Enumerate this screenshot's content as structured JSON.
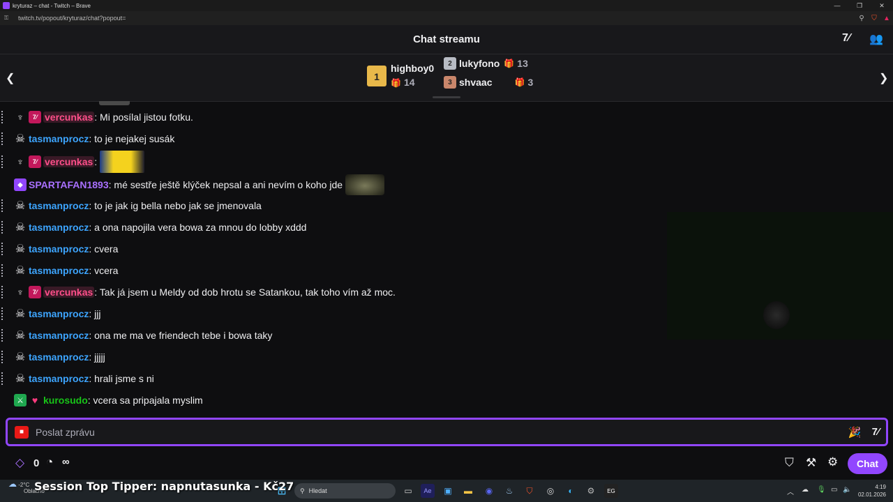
{
  "window": {
    "title": "kryturaz – chat - Twitch – Brave",
    "url": "twitch.tv/popout/kryturaz/chat?popout="
  },
  "header": {
    "title": "Chat streamu"
  },
  "leaderboard": {
    "entries": [
      {
        "rank": "1",
        "name": "highboy0",
        "count": "14"
      },
      {
        "rank": "2",
        "name": "lukyfono",
        "count": "13"
      },
      {
        "rank": "3",
        "name": "shvaac",
        "count": "3"
      }
    ]
  },
  "messages": [
    {
      "user": "vercunkas",
      "text": ": Mi posílal jistou fotku."
    },
    {
      "user": "tasmanprocz",
      "text": ": to je nejakej susák"
    },
    {
      "user": "vercunkas",
      "text": ":"
    },
    {
      "user": "SPARTAFAN1893",
      "text": ": mé sestře ještě klýček nepsal a ani nevím o koho jde"
    },
    {
      "user": "tasmanprocz",
      "text": ": to je jak ig bella nebo jak se jmenovala"
    },
    {
      "user": "tasmanprocz",
      "text": ": a ona napojila vera bowa za mnou do lobby xddd"
    },
    {
      "user": "tasmanprocz",
      "text": ": cvera"
    },
    {
      "user": "tasmanprocz",
      "text": ": vcera"
    },
    {
      "user": "vercunkas",
      "text": ": Tak já jsem u Meldy od dob hrotu se Satankou, tak toho vím až moc."
    },
    {
      "user": "tasmanprocz",
      "text": ": jjj"
    },
    {
      "user": "tasmanprocz",
      "text": ": ona me ma ve friendech tebe i bowa taky"
    },
    {
      "user": "tasmanprocz",
      "text": ": jjjjj"
    },
    {
      "user": "tasmanprocz",
      "text": ": hrali jsme s ni"
    },
    {
      "user": "kurosudo",
      "text": ": vcera sa pripajala myslim"
    }
  ],
  "input": {
    "placeholder": "Poslat zprávu"
  },
  "bottom": {
    "points": "0",
    "infinity": "∞",
    "chat_button": "Chat"
  },
  "overlay": {
    "tipper": "Session Top Tipper: napnutasunka - Kč27"
  },
  "taskbar": {
    "temp": "-2°C",
    "weather": "Oblačno",
    "search": "Hledat",
    "time": "4:19",
    "date": "02.01.2026"
  },
  "colors": {
    "accent": "#9146ff",
    "username_blue": "#3da5ff",
    "username_pink": "#ff4f8a",
    "username_purple": "#a970ff",
    "username_green": "#18c418"
  }
}
